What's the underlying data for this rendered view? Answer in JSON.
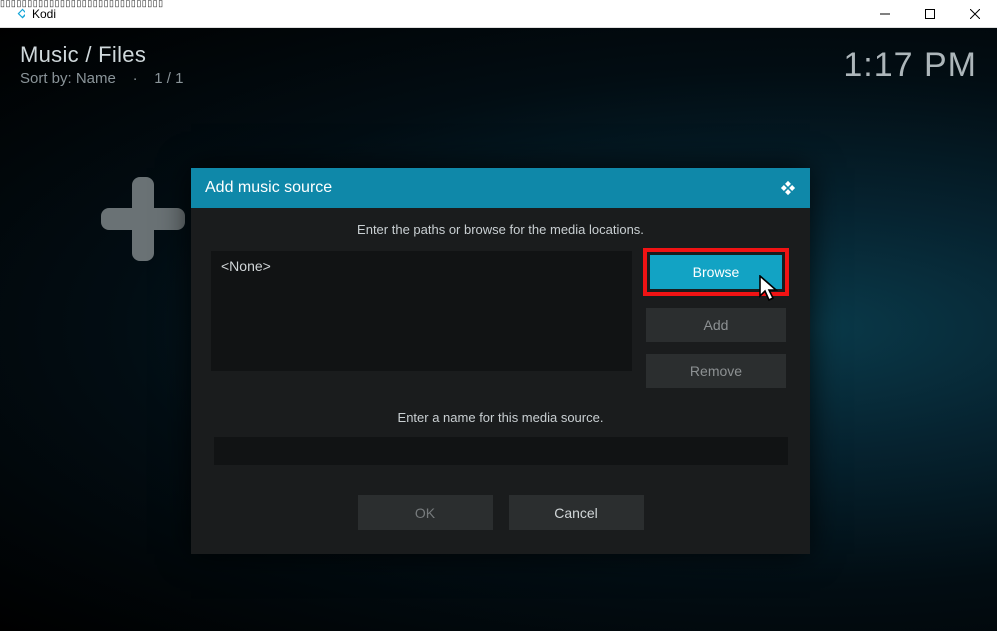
{
  "window": {
    "app_name": "Kodi",
    "ghost_text": "▯▯▯▯▯▯▯▯▯▯▯▯▯▯▯▯▯▯▯▯▯▯▯▯▯▯▯▯▯▯"
  },
  "header": {
    "breadcrumb": "Music / Files",
    "sort_label": "Sort by: Name",
    "page_counter": "1 / 1",
    "sort_sep": "·"
  },
  "clock": "1:17 PM",
  "plus_icon": "plus",
  "dialog": {
    "title": "Add music source",
    "instruction": "Enter the paths or browse for the media locations.",
    "path_value": "<None>",
    "browse_label": "Browse",
    "add_label": "Add",
    "remove_label": "Remove",
    "name_label": "Enter a name for this media source.",
    "name_value": "",
    "ok_label": "OK",
    "cancel_label": "Cancel"
  },
  "colors": {
    "accent": "#0f88a9",
    "highlight": "#f11314",
    "browse_bg": "#12a3c4"
  }
}
